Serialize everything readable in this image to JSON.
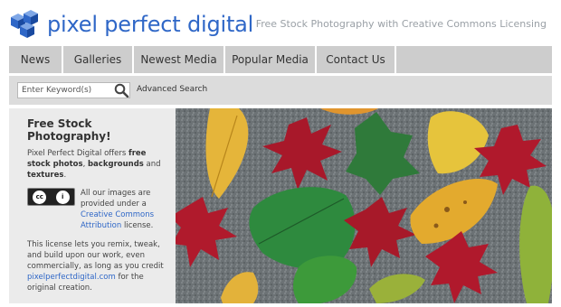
{
  "header": {
    "logo_text": "pixel perfect digital",
    "tagline": "Free Stock Photography with Creative Commons Licensing"
  },
  "nav": {
    "items": [
      {
        "label": "News"
      },
      {
        "label": "Galleries"
      },
      {
        "label": "Newest Media"
      },
      {
        "label": "Popular Media"
      },
      {
        "label": "Contact Us"
      }
    ]
  },
  "search": {
    "placeholder": "Enter Keyword(s)",
    "value": "",
    "advanced_label": "Advanced Search"
  },
  "sidebar": {
    "title": "Free Stock Photography!",
    "intro_pre": "Pixel Perfect Digital offers ",
    "intro_b1": "free stock photos",
    "intro_sep1": ", ",
    "intro_b2": "backgrounds",
    "intro_sep2": " and ",
    "intro_b3": "textures",
    "intro_end": ".",
    "cc_text_pre": "All our images are provided under a ",
    "cc_link": "Creative Commons Attribution",
    "cc_text_post": " license.",
    "license_pre": "This license lets you remix, tweak, and build upon our work, even commercially, as long as you credit ",
    "license_link": "pixelperfectdigital.com",
    "license_post": " for the original creation.",
    "cc_badge_left": "cc",
    "cc_badge_right": "i",
    "cc_badge_sub": "BY"
  },
  "colors": {
    "brand_blue": "#2f67c7",
    "nav_gray": "#cdcdcd",
    "sidebar_bg": "#ebebeb"
  },
  "icons": {
    "logo": "blue-cubes-icon",
    "search": "magnifier-icon",
    "cc": "creative-commons-badge-icon"
  },
  "image": {
    "subject": "autumn-leaves-photo"
  }
}
